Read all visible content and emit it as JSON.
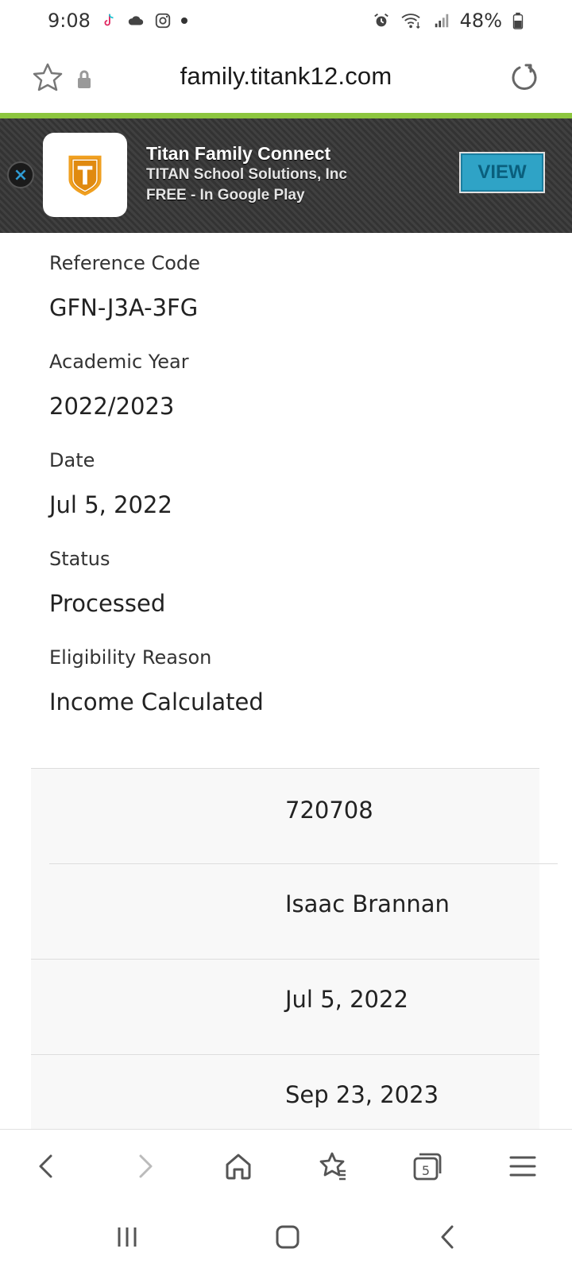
{
  "status_bar": {
    "time": "9:08",
    "battery": "48%",
    "left_icons": [
      "tiktok-icon",
      "cloud-icon",
      "instagram-icon",
      "dot-icon"
    ],
    "right_icons": [
      "alarm-icon",
      "wifi-icon",
      "signal-icon",
      "battery-icon"
    ]
  },
  "url_bar": {
    "url": "family.titank12.com"
  },
  "app_banner": {
    "title": "Titan Family Connect",
    "publisher": "TITAN School Solutions, Inc",
    "price_store": "FREE - In Google Play",
    "view_label": "VIEW",
    "icon_letter": "T"
  },
  "details": [
    {
      "label": "Reference Code",
      "value": "GFN-J3A-3FG"
    },
    {
      "label": "Academic Year",
      "value": "2022/2023"
    },
    {
      "label": "Date",
      "value": "Jul 5, 2022"
    },
    {
      "label": "Status",
      "value": "Processed"
    },
    {
      "label": "Eligibility Reason",
      "value": "Income Calculated"
    }
  ],
  "table_rows": [
    {
      "value": "720708"
    },
    {
      "value": "Isaac Brannan"
    },
    {
      "value": "Jul 5, 2022"
    },
    {
      "value": "Sep 23, 2023"
    }
  ],
  "bottom_nav": {
    "tabs_count": "5",
    "icons": [
      "back-icon",
      "forward-icon",
      "home-icon",
      "bookmarks-icon",
      "tabs-icon",
      "menu-icon"
    ]
  },
  "colors": {
    "accent_green": "#8dc63f",
    "banner_button": "#2fa3c6",
    "banner_icon_orange": "#f0a020"
  }
}
